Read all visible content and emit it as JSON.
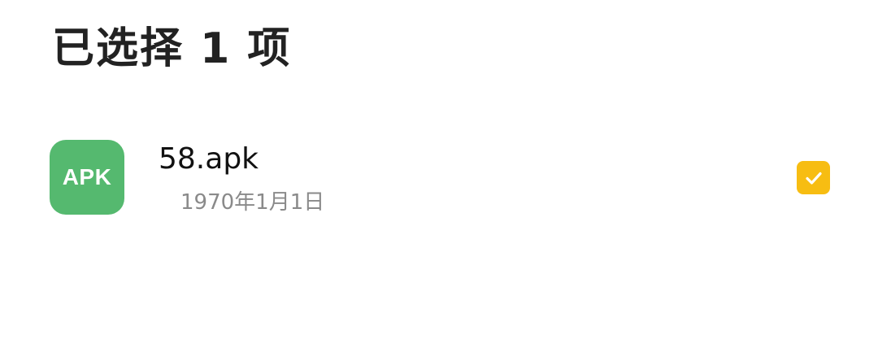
{
  "header": {
    "title": "已选择 1 项"
  },
  "files": [
    {
      "icon_label": "APK",
      "icon_color": "#55b96f",
      "name": "58.apk",
      "date": "1970年1月1日",
      "selected": true,
      "checkbox_color": "#f7bd12"
    }
  ]
}
